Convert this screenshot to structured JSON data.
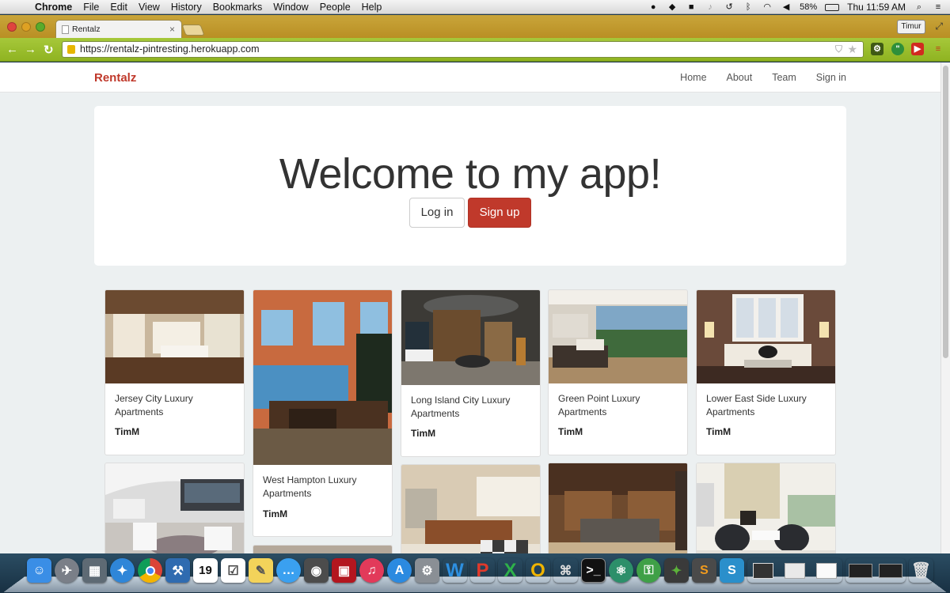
{
  "menubar": {
    "app_name": "Chrome",
    "menus": [
      "File",
      "Edit",
      "View",
      "History",
      "Bookmarks",
      "Window",
      "People",
      "Help"
    ],
    "battery": "58%",
    "clock": "Thu 11:59 AM"
  },
  "browser": {
    "tab_title": "Rentalz",
    "user_button": "Timur",
    "url": "https://rentalz-pintresting.herokuapp.com"
  },
  "site": {
    "brand": "Rentalz",
    "nav": [
      "Home",
      "About",
      "Team",
      "Sign in"
    ],
    "hero_title": "Welcome to my app!",
    "login_label": "Log in",
    "signup_label": "Sign up"
  },
  "listings": [
    {
      "title": "Jersey City Luxury Apartments",
      "author": "TimM"
    },
    {
      "title": "West Hampton Luxury Apartments",
      "author": "TimM"
    },
    {
      "title": "Long Island City Luxury Apartments",
      "author": "TimM"
    },
    {
      "title": "Green Point Luxury Apartments",
      "author": "TimM"
    },
    {
      "title": "Lower East Side Luxury Apartments",
      "author": "TimM"
    }
  ],
  "colors": {
    "brand": "#c0392b",
    "page_bg": "#ecf0f1",
    "toolbar": "#9cbf2e"
  },
  "dock_apps": [
    "finder-icon",
    "launchpad-icon",
    "preview-icon",
    "safari-icon",
    "chrome-icon",
    "xcode-icon",
    "calendar-icon",
    "reminders-icon",
    "notes-icon",
    "messages-icon",
    "facetime-icon",
    "photo-booth-icon",
    "itunes-icon",
    "app-store-icon",
    "system-preferences-icon",
    "word-icon",
    "powerpoint-icon",
    "excel-icon",
    "outlook-icon",
    "network-icon",
    "terminal-icon",
    "atom-icon",
    "keychain-icon",
    "evernote-icon",
    "sublime-icon",
    "express-icon",
    "window-thumbnails",
    "trash-icon"
  ],
  "dock_badges": {
    "calendar_day": "19"
  }
}
